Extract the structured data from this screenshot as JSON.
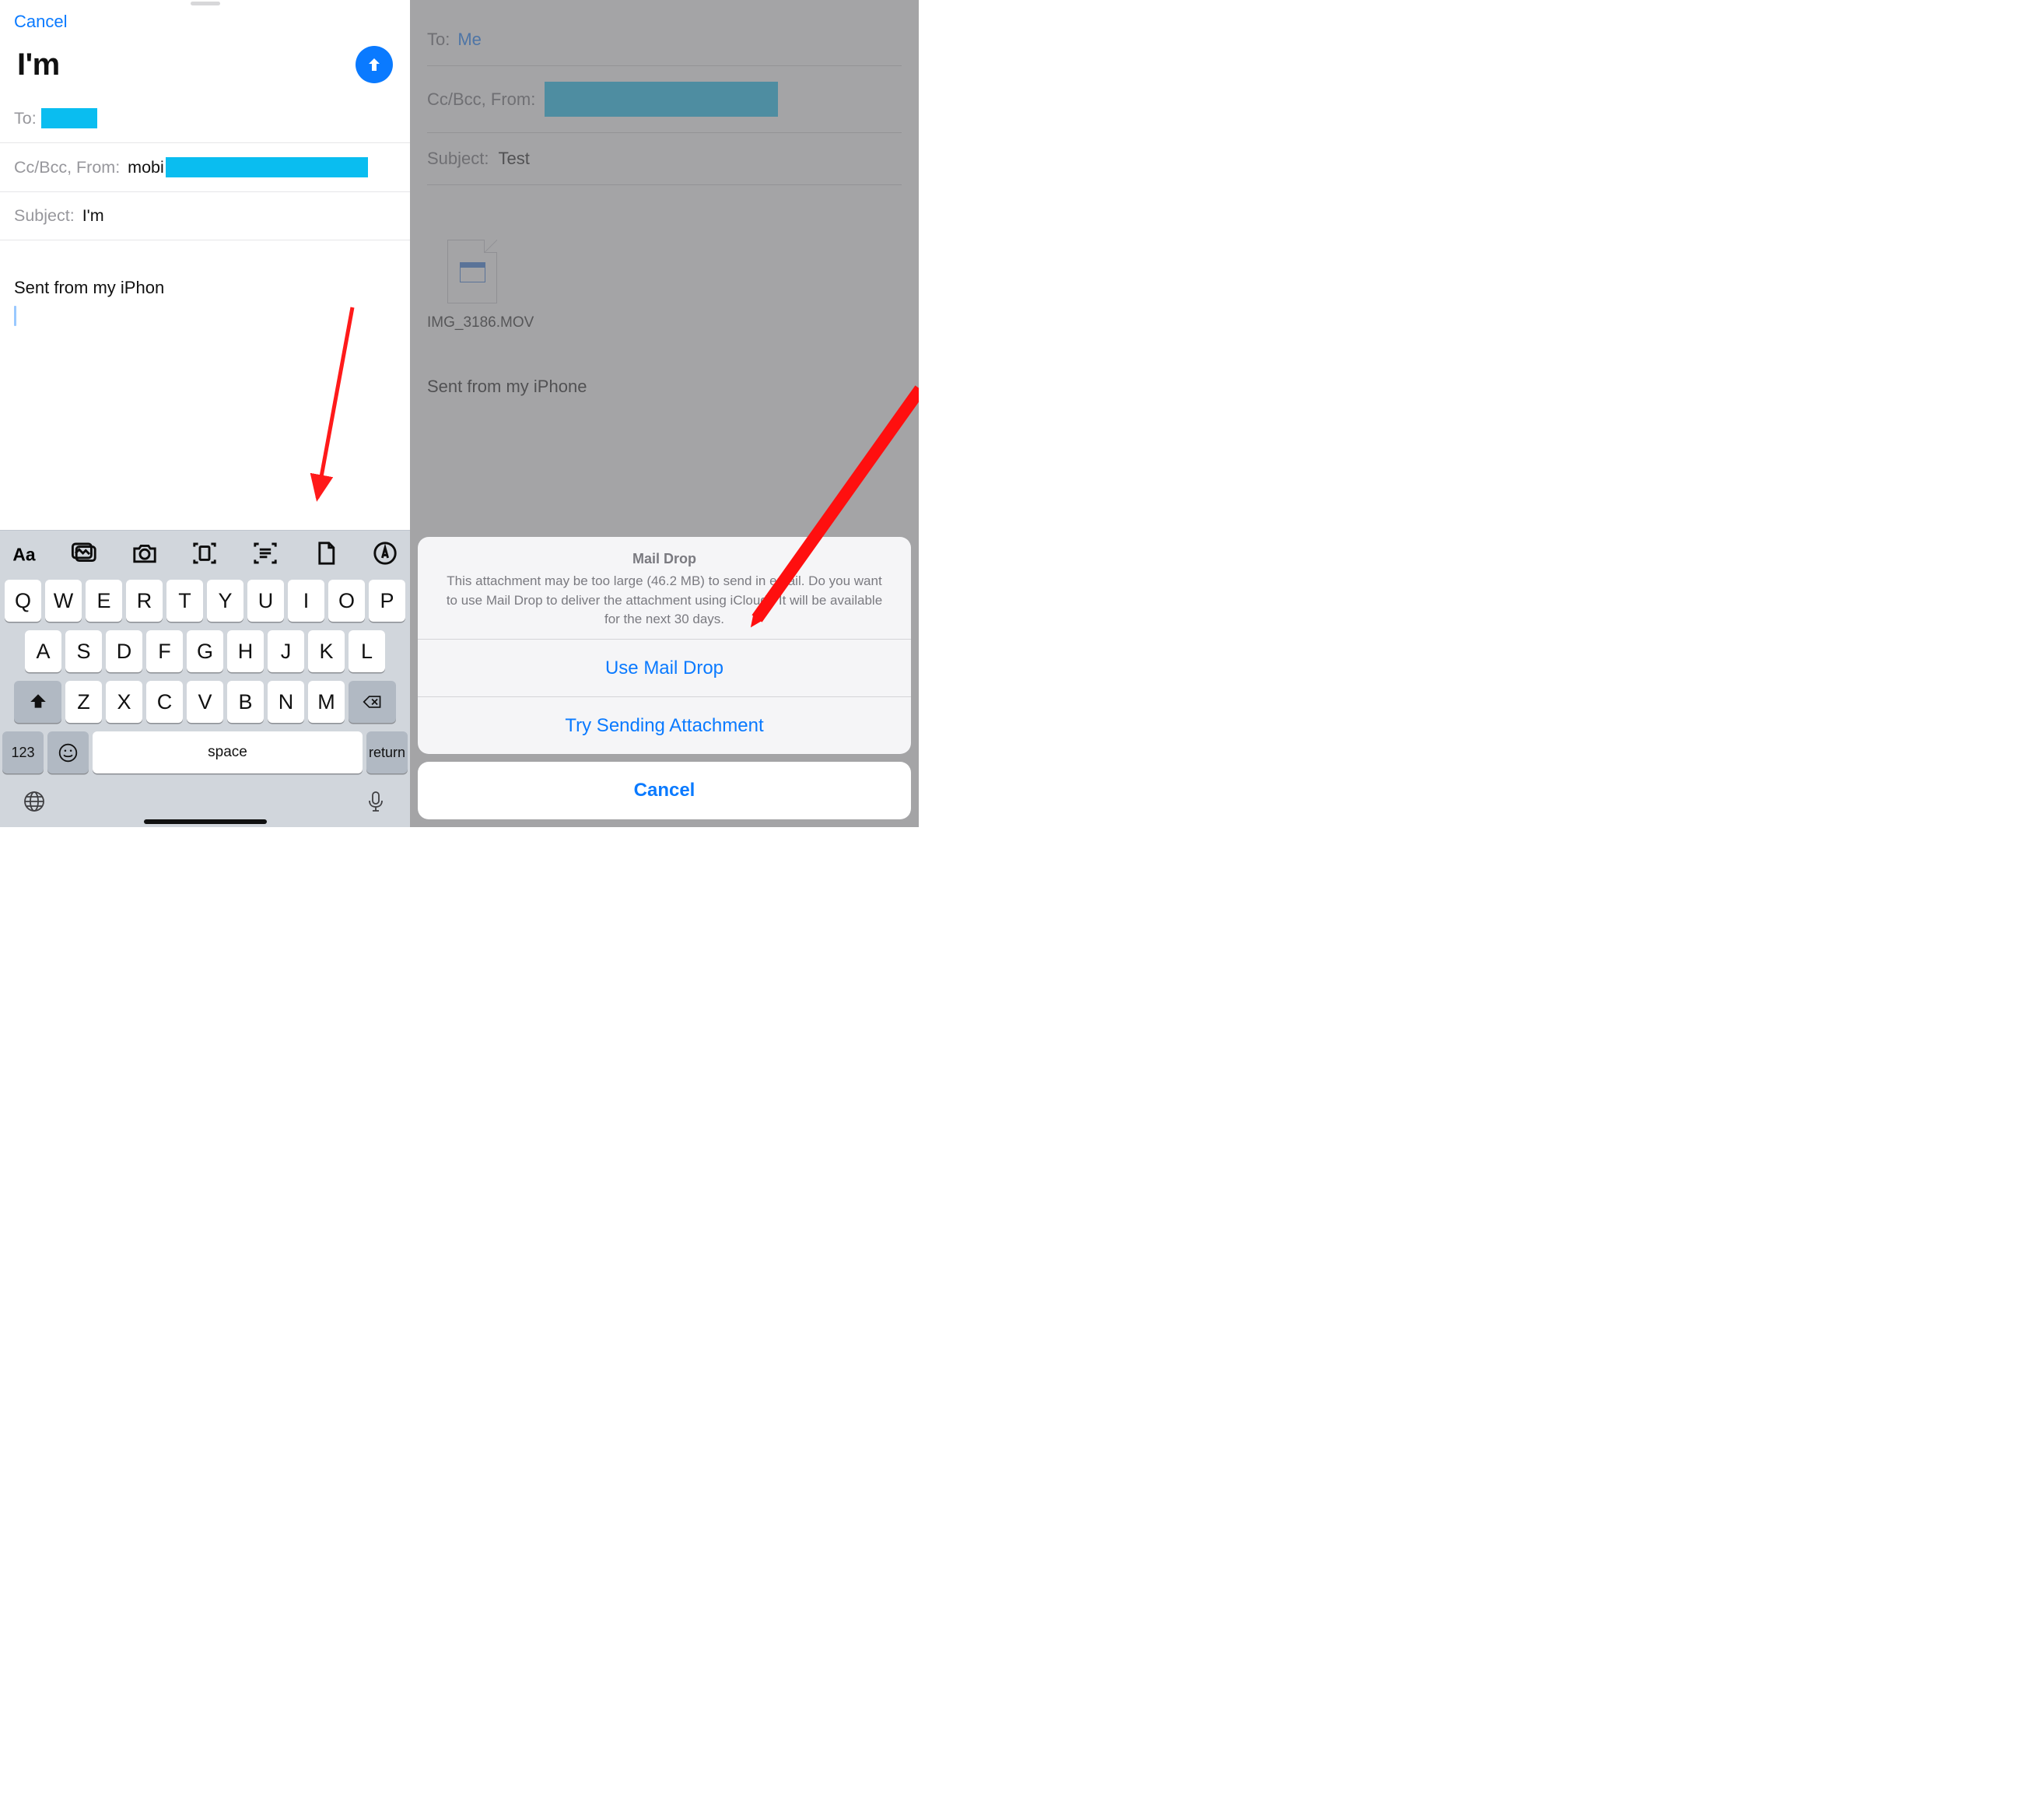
{
  "left": {
    "cancel": "Cancel",
    "title": "I'm",
    "to_label": "To:",
    "cc_from_label": "Cc/Bcc, From:",
    "from_value_visible": "mobi",
    "subject_label": "Subject:",
    "subject_value": "I'm",
    "signature": "Sent from my iPhon",
    "keyboard": {
      "row1": [
        "Q",
        "W",
        "E",
        "R",
        "T",
        "Y",
        "U",
        "I",
        "O",
        "P"
      ],
      "row2": [
        "A",
        "S",
        "D",
        "F",
        "G",
        "H",
        "J",
        "K",
        "L"
      ],
      "row3": [
        "Z",
        "X",
        "C",
        "V",
        "B",
        "N",
        "M"
      ],
      "num_key": "123",
      "space": "space",
      "return": "return"
    }
  },
  "right": {
    "to_label": "To:",
    "to_value": "Me",
    "cc_from_label": "Cc/Bcc, From:",
    "subject_label": "Subject:",
    "subject_value": "Test",
    "attachment_name": "IMG_3186.MOV",
    "signature": "Sent from my iPhone",
    "sheet": {
      "title": "Mail Drop",
      "message": "This attachment may be too large (46.2 MB) to send in email. Do you want to use Mail Drop to deliver the attachment using iCloud? It will be available for the next 30 days.",
      "use": "Use Mail Drop",
      "try": "Try Sending Attachment",
      "cancel": "Cancel"
    }
  }
}
